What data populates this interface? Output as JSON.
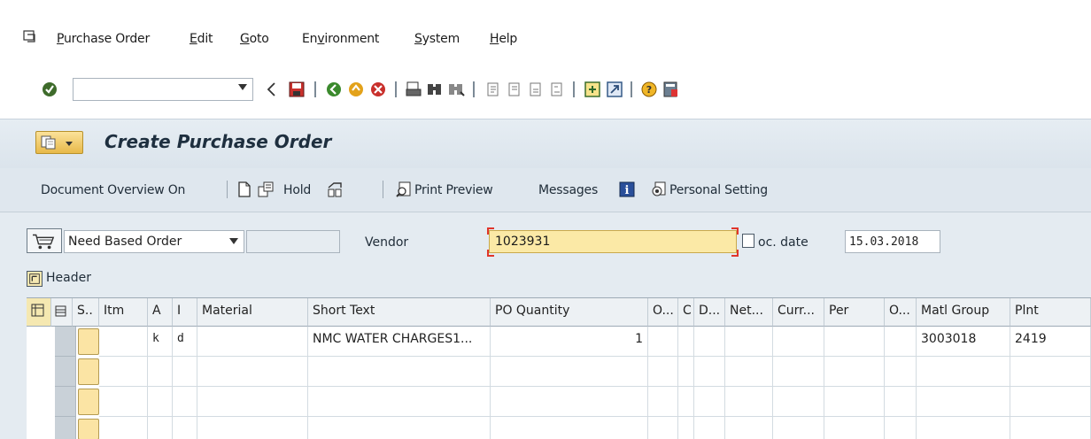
{
  "menu": {
    "items": [
      {
        "label": "Purchase Order",
        "underline": "P",
        "rest": "urchase Order"
      },
      {
        "label": "Edit",
        "underline": "E",
        "rest": "dit"
      },
      {
        "label": "Goto",
        "underline": "G",
        "rest": "oto"
      },
      {
        "label": "Environment",
        "pre": "En",
        "underline": "v",
        "rest": "ironment"
      },
      {
        "label": "System",
        "underline": "S",
        "rest": "ystem"
      },
      {
        "label": "Help",
        "underline": "H",
        "rest": "elp"
      }
    ]
  },
  "toolbar": {
    "command_field_value": "",
    "icons": [
      "enter-icon",
      "back-arrow-icon",
      "save-icon",
      "back-icon",
      "exit-icon",
      "cancel-icon",
      "print-icon",
      "find-icon",
      "find-next-icon",
      "first-page-icon",
      "previous-page-icon",
      "next-page-icon",
      "last-page-icon",
      "new-session-icon",
      "shortcut-icon",
      "help-icon",
      "layout-icon"
    ]
  },
  "title": {
    "text": "Create Purchase Order"
  },
  "app_toolbar": {
    "document_overview": "Document Overview On",
    "hold": "Hold",
    "print_preview": "Print Preview",
    "messages": "Messages",
    "personal_setting": "Personal Setting"
  },
  "header_fields": {
    "order_type": "Need Based Order",
    "vendor_label": "Vendor",
    "vendor_value": "1023931",
    "doc_date_label": "oc. date",
    "doc_date_value": "15.03.2018",
    "header_label": "Header"
  },
  "grid": {
    "columns": [
      "S..",
      "Itm",
      "A",
      "I",
      "Material",
      "Short Text",
      "PO Quantity",
      "O...",
      "C",
      "D...",
      "Net...",
      "Curr...",
      "Per",
      "O...",
      "Matl Group",
      "Plnt"
    ],
    "rows": [
      {
        "acct": "k",
        "item_cat": "d",
        "short_text": "NMC WATER CHARGES1...",
        "qty": "1",
        "matl_group": "3003018",
        "plant": "2419"
      },
      {
        "acct": "",
        "item_cat": "",
        "short_text": "",
        "qty": "",
        "matl_group": "",
        "plant": ""
      },
      {
        "acct": "",
        "item_cat": "",
        "short_text": "",
        "qty": "",
        "matl_group": "",
        "plant": ""
      },
      {
        "acct": "",
        "item_cat": "",
        "short_text": "",
        "qty": "",
        "matl_group": "",
        "plant": ""
      }
    ]
  },
  "colors": {
    "title_bg": "#dbe4ec",
    "vendor_highlight": "#fbe9a6",
    "focus_corner": "#e0362b"
  }
}
